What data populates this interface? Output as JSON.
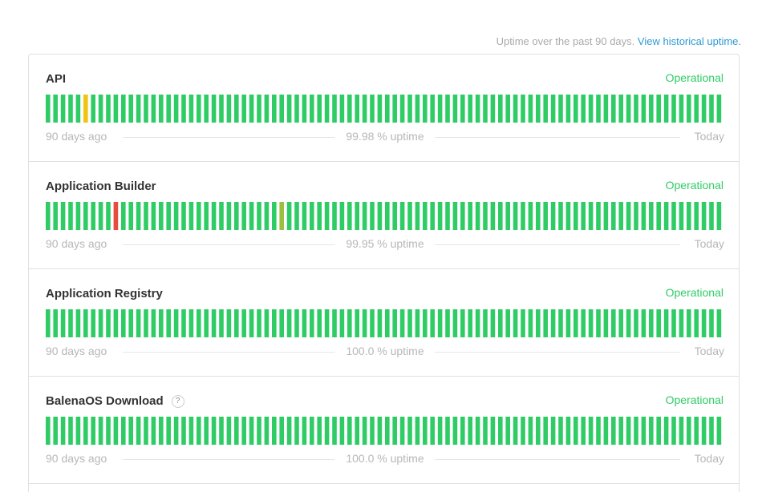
{
  "header": {
    "text": "Uptime over the past 90 days.",
    "link_label": "View historical uptime."
  },
  "colors": {
    "operational": "#2fcc66",
    "degraded_yellow": "#f1c40f",
    "minor_olive": "#9bbf3f",
    "major_outage": "#e74c3c",
    "link": "#2d9ad4"
  },
  "components": [
    {
      "name": "API",
      "status": "Operational",
      "has_help": false,
      "days_ago_label": "90 days ago",
      "uptime_label": "99.98 % uptime",
      "today_label": "Today",
      "bar_overrides": [
        {
          "index": 5,
          "color": "#f1c40f"
        }
      ]
    },
    {
      "name": "Application Builder",
      "status": "Operational",
      "has_help": false,
      "days_ago_label": "90 days ago",
      "uptime_label": "99.95 % uptime",
      "today_label": "Today",
      "bar_overrides": [
        {
          "index": 9,
          "color": "#e74c3c"
        },
        {
          "index": 31,
          "color": "#9bbf3f"
        }
      ]
    },
    {
      "name": "Application Registry",
      "status": "Operational",
      "has_help": false,
      "days_ago_label": "90 days ago",
      "uptime_label": "100.0 % uptime",
      "today_label": "Today",
      "bar_overrides": []
    },
    {
      "name": "BalenaOS Download",
      "status": "Operational",
      "has_help": true,
      "help_icon": "?",
      "days_ago_label": "90 days ago",
      "uptime_label": "100.0 % uptime",
      "today_label": "Today",
      "bar_overrides": []
    }
  ]
}
